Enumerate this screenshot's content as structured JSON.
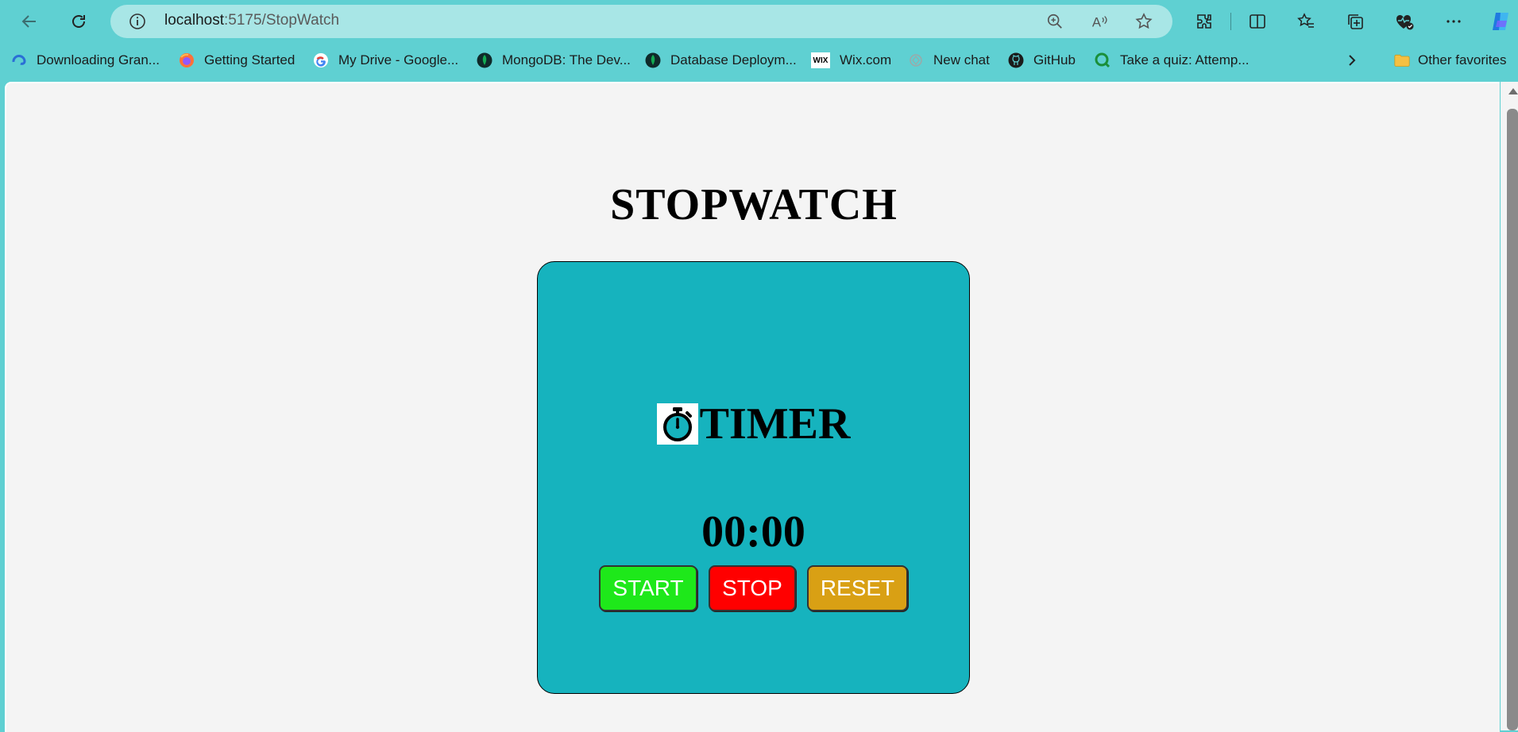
{
  "browser": {
    "url_host": "localhost",
    "url_path": ":5175/StopWatch"
  },
  "bookmarks": [
    {
      "label": "Downloading Gran...",
      "icon": "edge-loading-icon"
    },
    {
      "label": "Getting Started",
      "icon": "firefox-icon"
    },
    {
      "label": "My Drive - Google...",
      "icon": "google-icon"
    },
    {
      "label": "MongoDB: The Dev...",
      "icon": "mongodb-icon"
    },
    {
      "label": "Database Deploym...",
      "icon": "mongodb-icon"
    },
    {
      "label": "Wix.com",
      "icon": "wix-icon"
    },
    {
      "label": "New chat",
      "icon": "chatgpt-icon"
    },
    {
      "label": "GitHub",
      "icon": "github-icon"
    },
    {
      "label": "Take a quiz: Attemp...",
      "icon": "quiz-icon"
    }
  ],
  "other_favorites": "Other favorites",
  "wix_badge": "WIX",
  "page": {
    "title": "STOPWATCH",
    "timer_heading": "TIMER",
    "time": "00:00",
    "buttons": {
      "start": "START",
      "stop": "STOP",
      "reset": "RESET"
    }
  },
  "colors": {
    "browser_chrome": "#5fd0d2",
    "card": "#16b3be",
    "start": "#1ee81a",
    "stop": "#ff0000",
    "reset": "#d9a014"
  }
}
